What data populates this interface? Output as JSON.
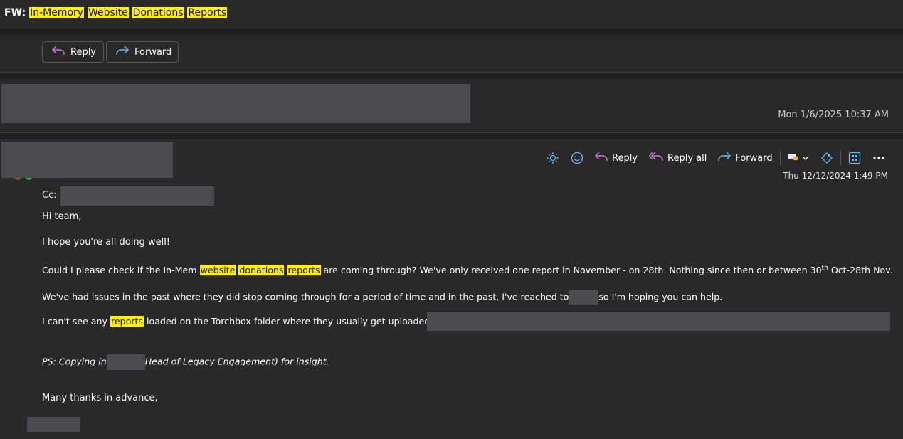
{
  "subject": {
    "prefix": "FW:",
    "words": [
      "In-Memory",
      "Website",
      "Donations",
      "Reports"
    ]
  },
  "actions": {
    "reply_label": "Reply",
    "forward_label": "Forward"
  },
  "message1": {
    "date": "Mon 1/6/2025 10:37 AM"
  },
  "message2": {
    "toolbar": {
      "reply": "Reply",
      "reply_all": "Reply all",
      "forward": "Forward"
    },
    "date": "Thu 12/12/2024 1:49 PM",
    "cc_label": "Cc:",
    "greeting": "Hi team,",
    "line1": "I hope you're all doing well!",
    "line2": {
      "a": "Could I please check if the In-Mem ",
      "h1": "website",
      "h2": "donations",
      "h3": "reports",
      "b": " are coming through? We've only received one report in November - on 28th. Nothing since then or between 30",
      "sup": "th",
      "c": " Oct-28th Nov."
    },
    "line3": {
      "a": "We've had issues in the past where they did stop coming through for a period of time and in the past, I've reached to",
      "b": "so I'm hoping you can help."
    },
    "line4": {
      "a": "I can't see any ",
      "h": "reports",
      "b": " loaded on the Torchbox folder where they usually get uploaded: "
    },
    "ps": {
      "a": "PS: Copying in",
      "b": "Head of Legacy Engagement) for insight."
    },
    "closing": "Many thanks in advance,"
  },
  "colors": {
    "background": "#292929",
    "highlight": "#fff100",
    "separator": "#1f1f1f",
    "redaction": "#4a4a4f"
  }
}
